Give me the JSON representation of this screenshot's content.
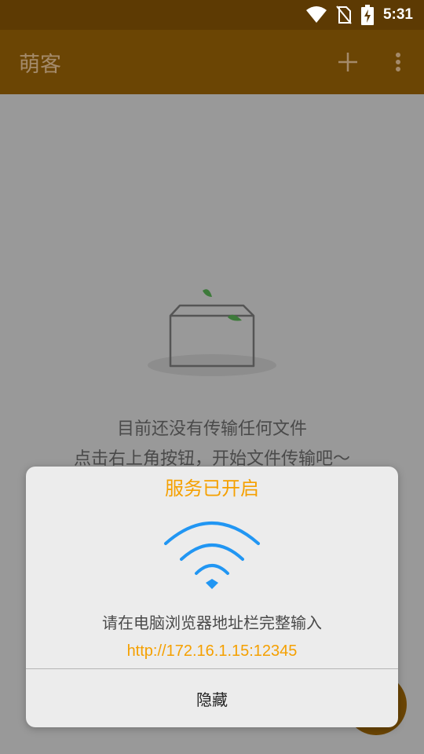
{
  "status_bar": {
    "time": "5:31",
    "icons": [
      "wifi-icon",
      "no-sim-icon",
      "battery-charging-icon"
    ]
  },
  "app_bar": {
    "title": "萌客",
    "actions": [
      "add-icon",
      "more-vert-icon"
    ]
  },
  "empty_state": {
    "illustration": "empty-box-icon",
    "line1": "目前还没有传输任何文件",
    "line2": "点击右上角按钮，开始文件传输吧～"
  },
  "dialog": {
    "title": "服务已开启",
    "icon": "wifi-signal-icon",
    "message": "请在电脑浏览器地址栏完整输入",
    "url": "http://172.16.1.15:12345",
    "hide_label": "隐藏"
  },
  "colors": {
    "app_bar": "#6b4504",
    "status_bar": "#5d3a03",
    "accent_orange": "#f5a000",
    "wifi_blue": "#2196f3",
    "leaf_green": "#3d7a3a"
  }
}
